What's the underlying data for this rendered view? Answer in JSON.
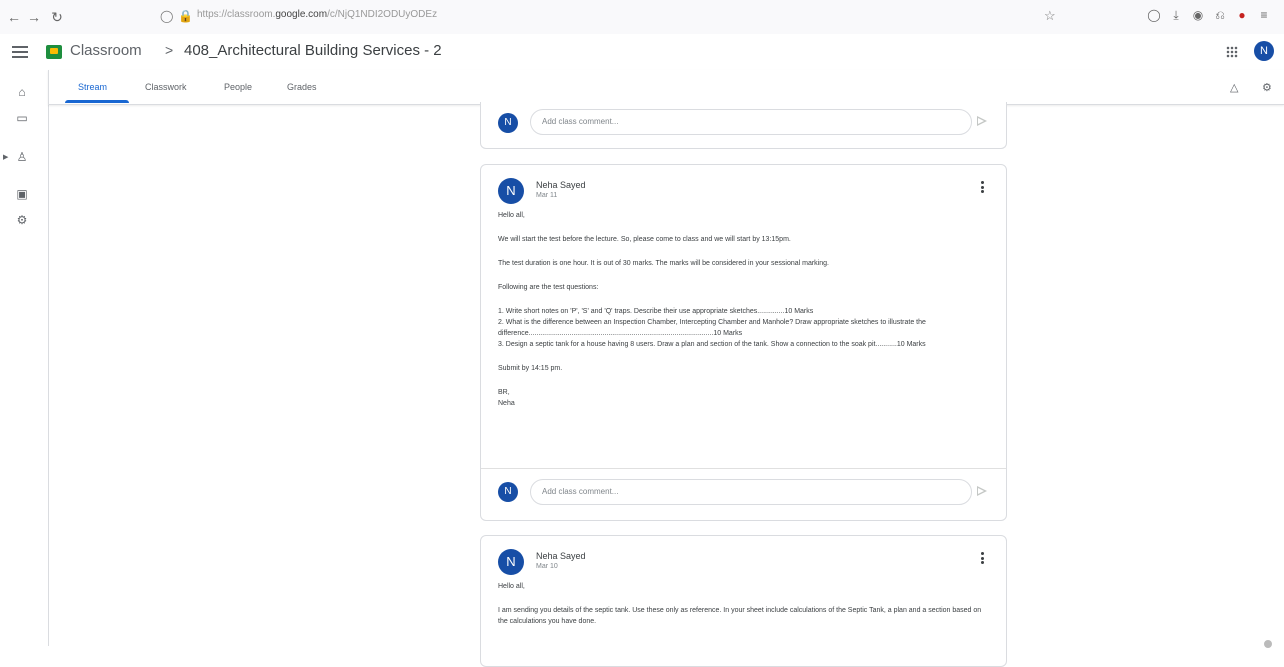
{
  "browser": {
    "url_prefix": "https://classroom.",
    "url_domain": "google.com",
    "url_path": "/c/NjQ1NDI2ODUyODEz",
    "icons": [
      "back-icon",
      "forward-icon",
      "reload-icon",
      "shield-icon",
      "lock-icon",
      "star-icon",
      "pocket-icon",
      "download-icon",
      "account-icon",
      "extensions-icon",
      "addon-icon",
      "menu-icon"
    ]
  },
  "header": {
    "app_name": "Classroom",
    "separator": ">",
    "class_name": "408_Architectural Building Services - 2",
    "avatar_letter": "N"
  },
  "tabs": [
    {
      "label": "Stream",
      "active": true
    },
    {
      "label": "Classwork",
      "active": false
    },
    {
      "label": "People",
      "active": false
    },
    {
      "label": "Grades",
      "active": false
    }
  ],
  "comment_placeholder": "Add class comment...",
  "posts": [
    {
      "avatar_letter": "N",
      "author": "Neha Sayed",
      "date": "Mar 11",
      "greeting": "Hello all,",
      "p1": "We will start the test before the lecture. So, please come to class and we will start by 13:15pm.",
      "p2": "The test duration is one hour. It is out of 30 marks. The marks will be considered in your sessional marking.",
      "p3": "Following are the test questions:",
      "q1": "1. Write short notes on 'P', 'S' and 'Q' traps. Describe their use appropriate sketches..............10 Marks",
      "q2": "2. What is the difference between an Inspection Chamber, Intercepting Chamber and Manhole? Draw appropriate sketches to illustrate the difference...............................................................................................10 Marks",
      "q3": "3. Design a septic tank for a house having 8 users. Draw a plan and section of the tank. Show a connection to the soak pit...........10 Marks",
      "p4": "Submit by 14:15 pm.",
      "sign1": "BR,",
      "sign2": "Neha"
    },
    {
      "avatar_letter": "N",
      "author": "Neha Sayed",
      "date": "Mar 10",
      "greeting": "Hello all,",
      "p1": "I am sending you details of the septic tank. Use these only as reference. In your sheet include calculations of the Septic Tank, a plan and a section based on the calculations you have done."
    }
  ]
}
